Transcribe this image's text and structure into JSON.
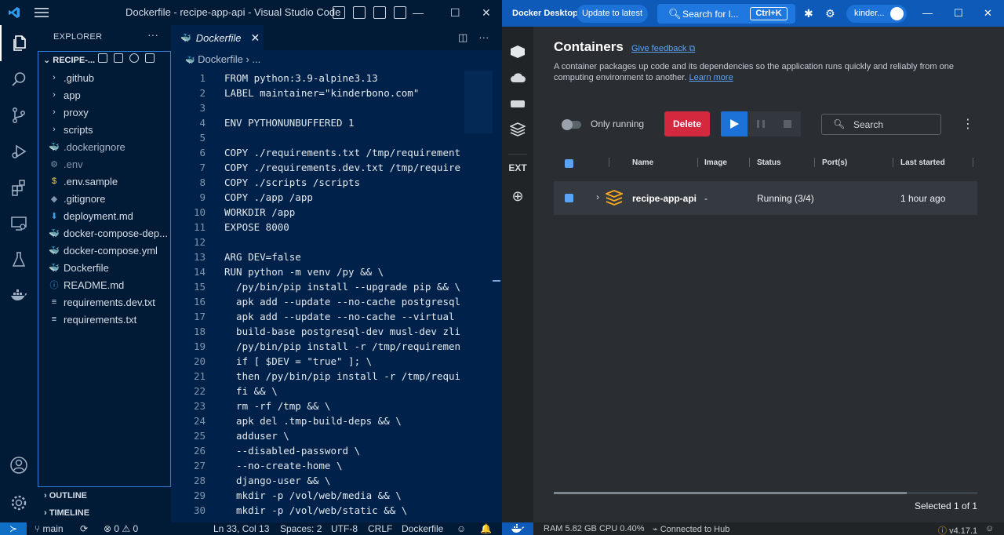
{
  "vscode": {
    "title": "Dockerfile - recipe-app-api - Visual Studio Code",
    "explorer": {
      "header": "EXPLORER",
      "more": "···",
      "root": "RECIPE-...",
      "items": [
        {
          "icon": "›",
          "label": ".github"
        },
        {
          "icon": "›",
          "label": "app"
        },
        {
          "icon": "›",
          "label": "proxy"
        },
        {
          "icon": "›",
          "label": "scripts"
        },
        {
          "icon": "🐳",
          "label": ".dockerignore"
        },
        {
          "icon": "⚙",
          "label": ".env"
        },
        {
          "icon": "$",
          "label": ".env.sample"
        },
        {
          "icon": "◆",
          "label": ".gitignore"
        },
        {
          "icon": "⬇",
          "label": "deployment.md"
        },
        {
          "icon": "🐳",
          "label": "docker-compose-dep..."
        },
        {
          "icon": "🐳",
          "label": "docker-compose.yml"
        },
        {
          "icon": "🐳",
          "label": "Dockerfile"
        },
        {
          "icon": "ⓘ",
          "label": "README.md"
        },
        {
          "icon": "≡",
          "label": "requirements.dev.txt"
        },
        {
          "icon": "≡",
          "label": "requirements.txt"
        }
      ],
      "outline": "OUTLINE",
      "timeline": "TIMELINE"
    },
    "tab": {
      "label": "Dockerfile",
      "close": "✕"
    },
    "breadcrumb": "Dockerfile › ...",
    "code": [
      {
        "n": "1",
        "t": "FROM python:3.9-alpine3.13"
      },
      {
        "n": "2",
        "t": "LABEL maintainer=\"kinderbono.com\""
      },
      {
        "n": "3",
        "t": ""
      },
      {
        "n": "4",
        "t": "ENV PYTHONUNBUFFERED 1"
      },
      {
        "n": "5",
        "t": ""
      },
      {
        "n": "6",
        "t": "COPY ./requirements.txt /tmp/requirement"
      },
      {
        "n": "7",
        "t": "COPY ./requirements.dev.txt /tmp/require"
      },
      {
        "n": "8",
        "t": "COPY ./scripts /scripts"
      },
      {
        "n": "9",
        "t": "COPY ./app /app"
      },
      {
        "n": "10",
        "t": "WORKDIR /app"
      },
      {
        "n": "11",
        "t": "EXPOSE 8000"
      },
      {
        "n": "12",
        "t": ""
      },
      {
        "n": "13",
        "t": "ARG DEV=false"
      },
      {
        "n": "14",
        "t": "RUN python -m venv /py && \\"
      },
      {
        "n": "15",
        "t": "  /py/bin/pip install --upgrade pip && \\"
      },
      {
        "n": "16",
        "t": "  apk add --update --no-cache postgresql"
      },
      {
        "n": "17",
        "t": "  apk add --update --no-cache --virtual"
      },
      {
        "n": "18",
        "t": "  build-base postgresql-dev musl-dev zli"
      },
      {
        "n": "19",
        "t": "  /py/bin/pip install -r /tmp/requiremen"
      },
      {
        "n": "20",
        "t": "  if [ $DEV = \"true\" ]; \\"
      },
      {
        "n": "21",
        "t": "  then /py/bin/pip install -r /tmp/requi"
      },
      {
        "n": "22",
        "t": "  fi && \\"
      },
      {
        "n": "23",
        "t": "  rm -rf /tmp && \\"
      },
      {
        "n": "24",
        "t": "  apk del .tmp-build-deps && \\"
      },
      {
        "n": "25",
        "t": "  adduser \\"
      },
      {
        "n": "26",
        "t": "  --disabled-password \\"
      },
      {
        "n": "27",
        "t": "  --no-create-home \\"
      },
      {
        "n": "28",
        "t": "  django-user && \\"
      },
      {
        "n": "29",
        "t": "  mkdir -p /vol/web/media && \\"
      },
      {
        "n": "30",
        "t": "  mkdir -p /vol/web/static && \\"
      }
    ],
    "status": {
      "branch": "main",
      "errors": "⊗ 0 ⚠ 0",
      "position": "Ln 33, Col 13",
      "spaces": "Spaces: 2",
      "encoding": "UTF-8",
      "eol": "CRLF",
      "language": "Dockerfile"
    }
  },
  "docker": {
    "brand": "Docker Desktop",
    "update": "Update to latest",
    "search_label": "Search for l...",
    "search_kbd": "Ctrl+K",
    "user": "kinder...",
    "ext_label": "EXT",
    "title": "Containers",
    "feedback": "Give feedback",
    "description": "A container packages up code and its dependencies so the application runs quickly and reliably from one computing environment to another.",
    "learn_more": "Learn more",
    "only_running": "Only running",
    "delete": "Delete",
    "search": "Search",
    "columns": [
      "Name",
      "Image",
      "Status",
      "Port(s)",
      "Last started"
    ],
    "row": {
      "name": "recipe-app-api",
      "image": "-",
      "status": "Running (3/4)",
      "ports": "",
      "last_started": "1 hour ago"
    },
    "selected": "Selected 1 of 1",
    "status": {
      "ram": "RAM 5.82 GB",
      "cpu": "CPU 0.40%",
      "hub": "Connected to Hub",
      "version": "v4.17.1"
    },
    "colors": {
      "accent": "#1d72d8",
      "delete": "#d4283f",
      "icon": "#f5a623"
    }
  }
}
